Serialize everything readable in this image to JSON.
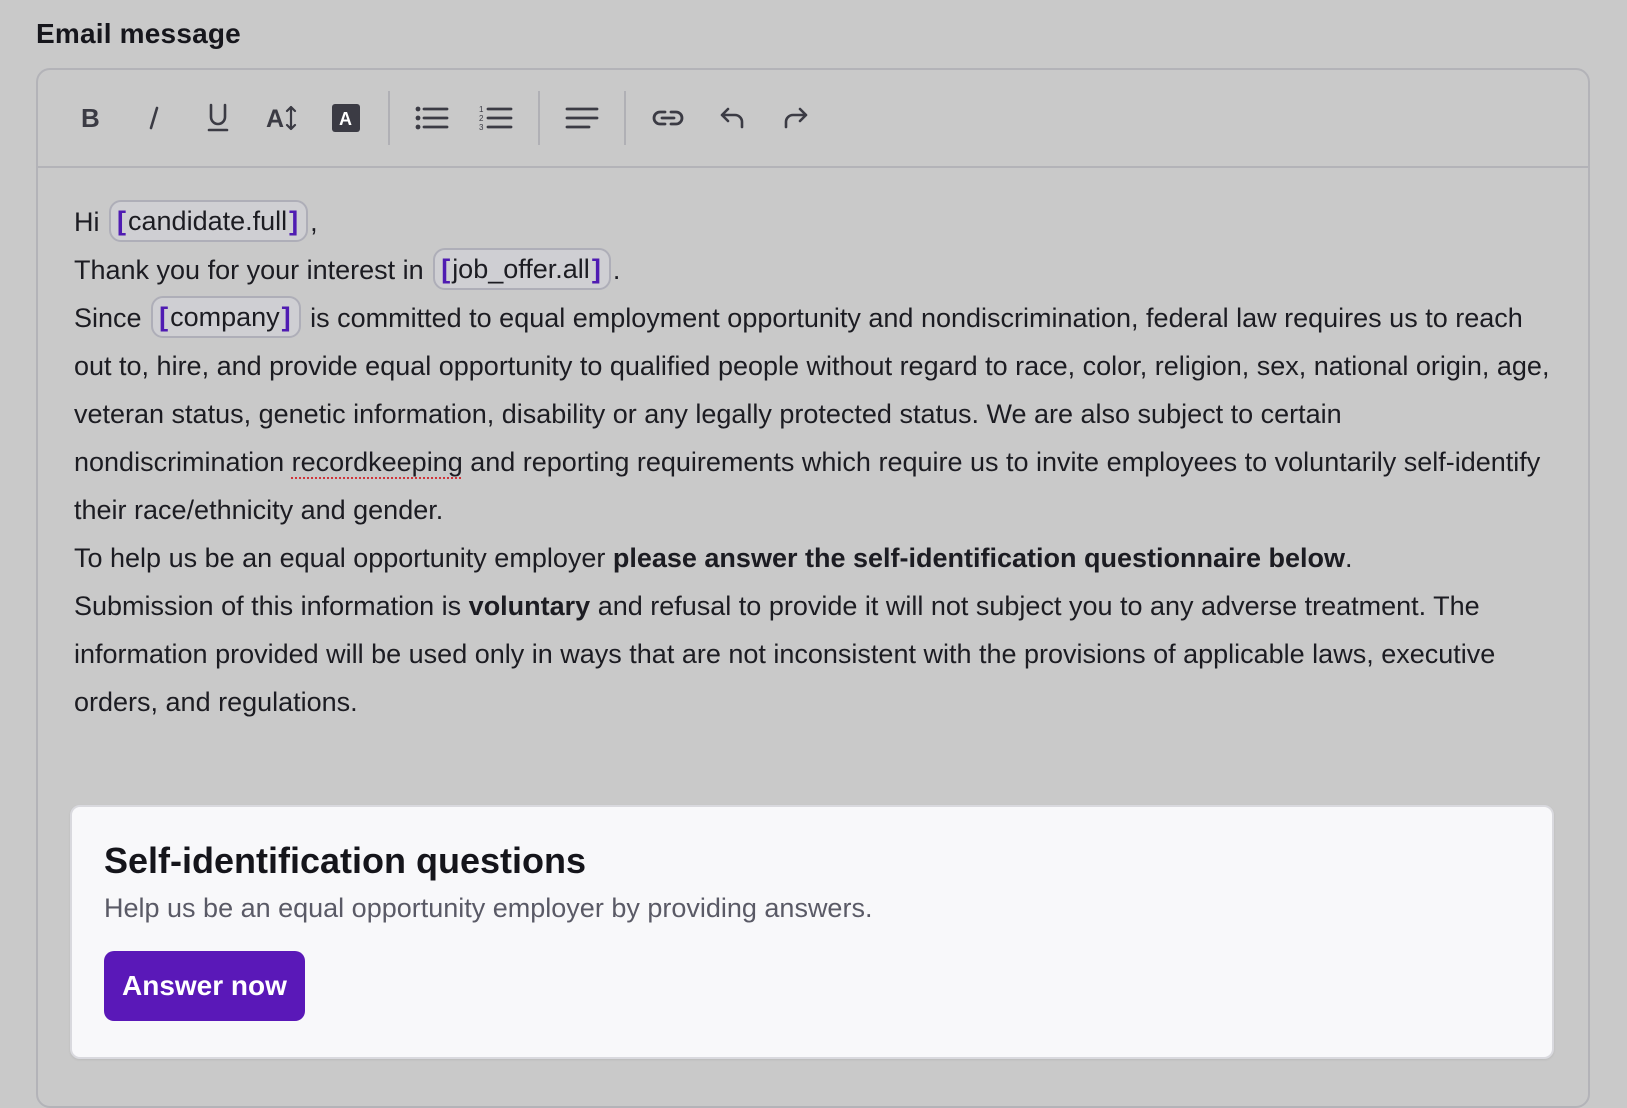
{
  "field_label": "Email message",
  "toolbar": {
    "buttons": [
      {
        "name": "bold-icon",
        "glyph": "B"
      },
      {
        "name": "italic-icon",
        "glyph": "I"
      },
      {
        "name": "underline-icon",
        "glyph": "U"
      },
      {
        "name": "font-size-icon",
        "glyph": "A↕"
      },
      {
        "name": "text-highlight-icon",
        "glyph": "A"
      },
      {
        "name": "bulleted-list-icon"
      },
      {
        "name": "numbered-list-icon"
      },
      {
        "name": "align-left-icon"
      },
      {
        "name": "link-icon"
      },
      {
        "name": "undo-icon"
      },
      {
        "name": "redo-icon"
      }
    ]
  },
  "body": {
    "line1_prefix": "Hi",
    "tag_candidate": "candidate.full",
    "line1_suffix": ",",
    "line2_prefix": "Thank you for your interest in",
    "tag_job_offer": "job_offer.all",
    "line2_suffix": ".",
    "line3_prefix": "Since",
    "tag_company": "company",
    "para1_part1": " is committed to equal employment opportunity and nondiscrimination, federal law requires us to reach out to, hire, and provide equal opportunity to qualified people without regard to race, color, religion, sex, national origin, age, veteran status, genetic information, disability or any legally protected status. We are also subject to certain nondiscrimination ",
    "para1_misspelled": "recordkeeping",
    "para1_part2": " and reporting requirements which require us to invite employees to voluntarily self-identify their race/ethnicity and gender.",
    "para2_prefix": "To help us be an equal opportunity employer ",
    "para2_bold": "please answer the self-identification questionnaire below",
    "para2_suffix": ".",
    "para3_prefix": "Submission of this information is ",
    "para3_bold": "voluntary",
    "para3_suffix": " and refusal to provide it will not subject you to any adverse treatment. The information provided will be used only in ways that are not inconsistent with the provisions of applicable laws, executive orders, and regulations."
  },
  "card": {
    "title": "Self-identification questions",
    "subtitle": "Help us be an equal opportunity employer by providing answers.",
    "button_label": "Answer now"
  },
  "colors": {
    "accent": "#5a18b8",
    "tag_bracket": "#4f1bb2",
    "background": "#c9c9c9"
  }
}
